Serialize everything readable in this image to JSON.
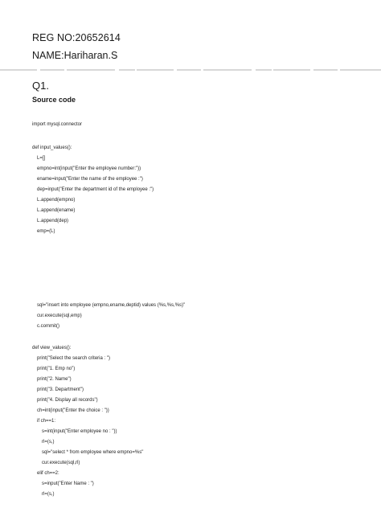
{
  "header": {
    "reg_no": "REG NO:20652614",
    "name": "NAME:Hariharan.S"
  },
  "question": {
    "label": "Q1.",
    "section_title": "Source code"
  },
  "code_lines": [
    "import mysql.connector",
    "def input_values():",
    "L=[]",
    "empno=int(input(\"Enter the employee number:\"))",
    "ename=input(\"Enter the name of the employee :\")",
    "dep=input(\"Enter the department id of the employee :\")",
    "L.append(empno)",
    "L.append(ename)",
    "L.append(dep)",
    "emp=(L)",
    "sql=\"insert into employee (empno,ename,deptid) values (%s,%s,%s)\"",
    "cur.execute(sql,emp)",
    "c.commit()",
    "def view_values():",
    "print(\"Select the search criteria : \")",
    "print(\"1. Emp no\")",
    "print(\"2. Name\")",
    "print(\"3. Department\")",
    "print(\"4. Display all records\")",
    "ch=int(input(\"Enter the choice : \"))",
    "if ch==1:",
    "s=int(input(\"Enter employee no : \"))",
    "rl=(s,)",
    "sql=\"select * from employee where empno=%s\"",
    "cur.execute(sql,rl)",
    "elif ch==2:",
    "s=input(\"Enter Name : \")",
    "rl=(s,)"
  ]
}
